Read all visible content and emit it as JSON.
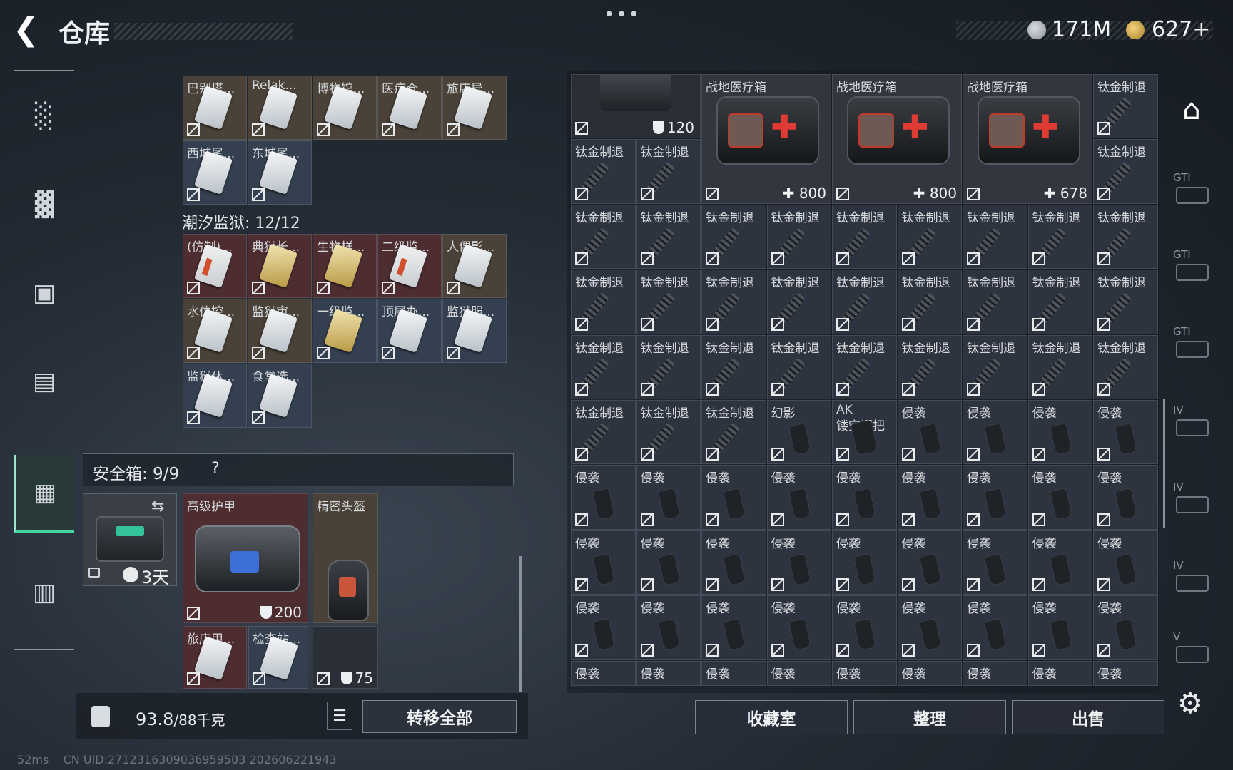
{
  "header": {
    "title": "仓库",
    "currency_1": "171M",
    "currency_2": "627+",
    "menu_dots": "•••"
  },
  "left_nav": {
    "items": [
      "weapon-icon",
      "armor-vest-icon",
      "backpack-icon",
      "chest-rig-icon",
      "safe-box-icon",
      "briefcase-icon"
    ],
    "active_index": 4
  },
  "left_stash": {
    "top_cards": [
      "巴别塔...",
      "Relak...",
      "博物馆...",
      "医疗仓...",
      "旅店异...",
      "西城尾...",
      "东城尾..."
    ],
    "tide_section": {
      "title": "潮汐监狱: 12/12",
      "cards": [
        "(仿制)...",
        "典狱长...",
        "生物样...",
        "二级监...",
        "人偶影...",
        "水位控...",
        "监狱审...",
        "一级监...",
        "顶层办...",
        "监狱服...",
        "监狱休...",
        "食堂选..."
      ]
    }
  },
  "safe_box": {
    "label": "安全箱: 9/9",
    "help": "?",
    "timer": "3天",
    "armor_label": "高级护甲",
    "armor_value": "200",
    "helmet_label": "精密头盔",
    "helmet_value": "75",
    "slot_cards": [
      "旅店甲...",
      "检查站..."
    ]
  },
  "bottom_left": {
    "weight": "93.8",
    "weight_cap": "/88千克",
    "transfer_label": "转移全部"
  },
  "right_stash": {
    "top_value": "120",
    "medkit_label": "战地医疗箱",
    "medkit_values": [
      "800",
      "800",
      "678"
    ],
    "muzzle_label": "钛金制退",
    "phantom_label": "幻影",
    "ak_label_1": "AK",
    "ak_label_2": "镂空握把",
    "grip_label": "侵袭"
  },
  "bottom_right": {
    "collection_label": "收藏室",
    "sort_label": "整理",
    "sell_label": "出售"
  },
  "right_nav": {
    "tags": [
      "GTI",
      "GTI",
      "GTI",
      "IV",
      "IV",
      "IV",
      "V"
    ]
  },
  "footer": {
    "ping": "52ms",
    "uid": "CN UID:2712316309036959503 202606221943"
  },
  "colors": {
    "accent": "#41d7a5",
    "gold_bg": "#4a4238",
    "red_bg": "#4e2d31"
  }
}
